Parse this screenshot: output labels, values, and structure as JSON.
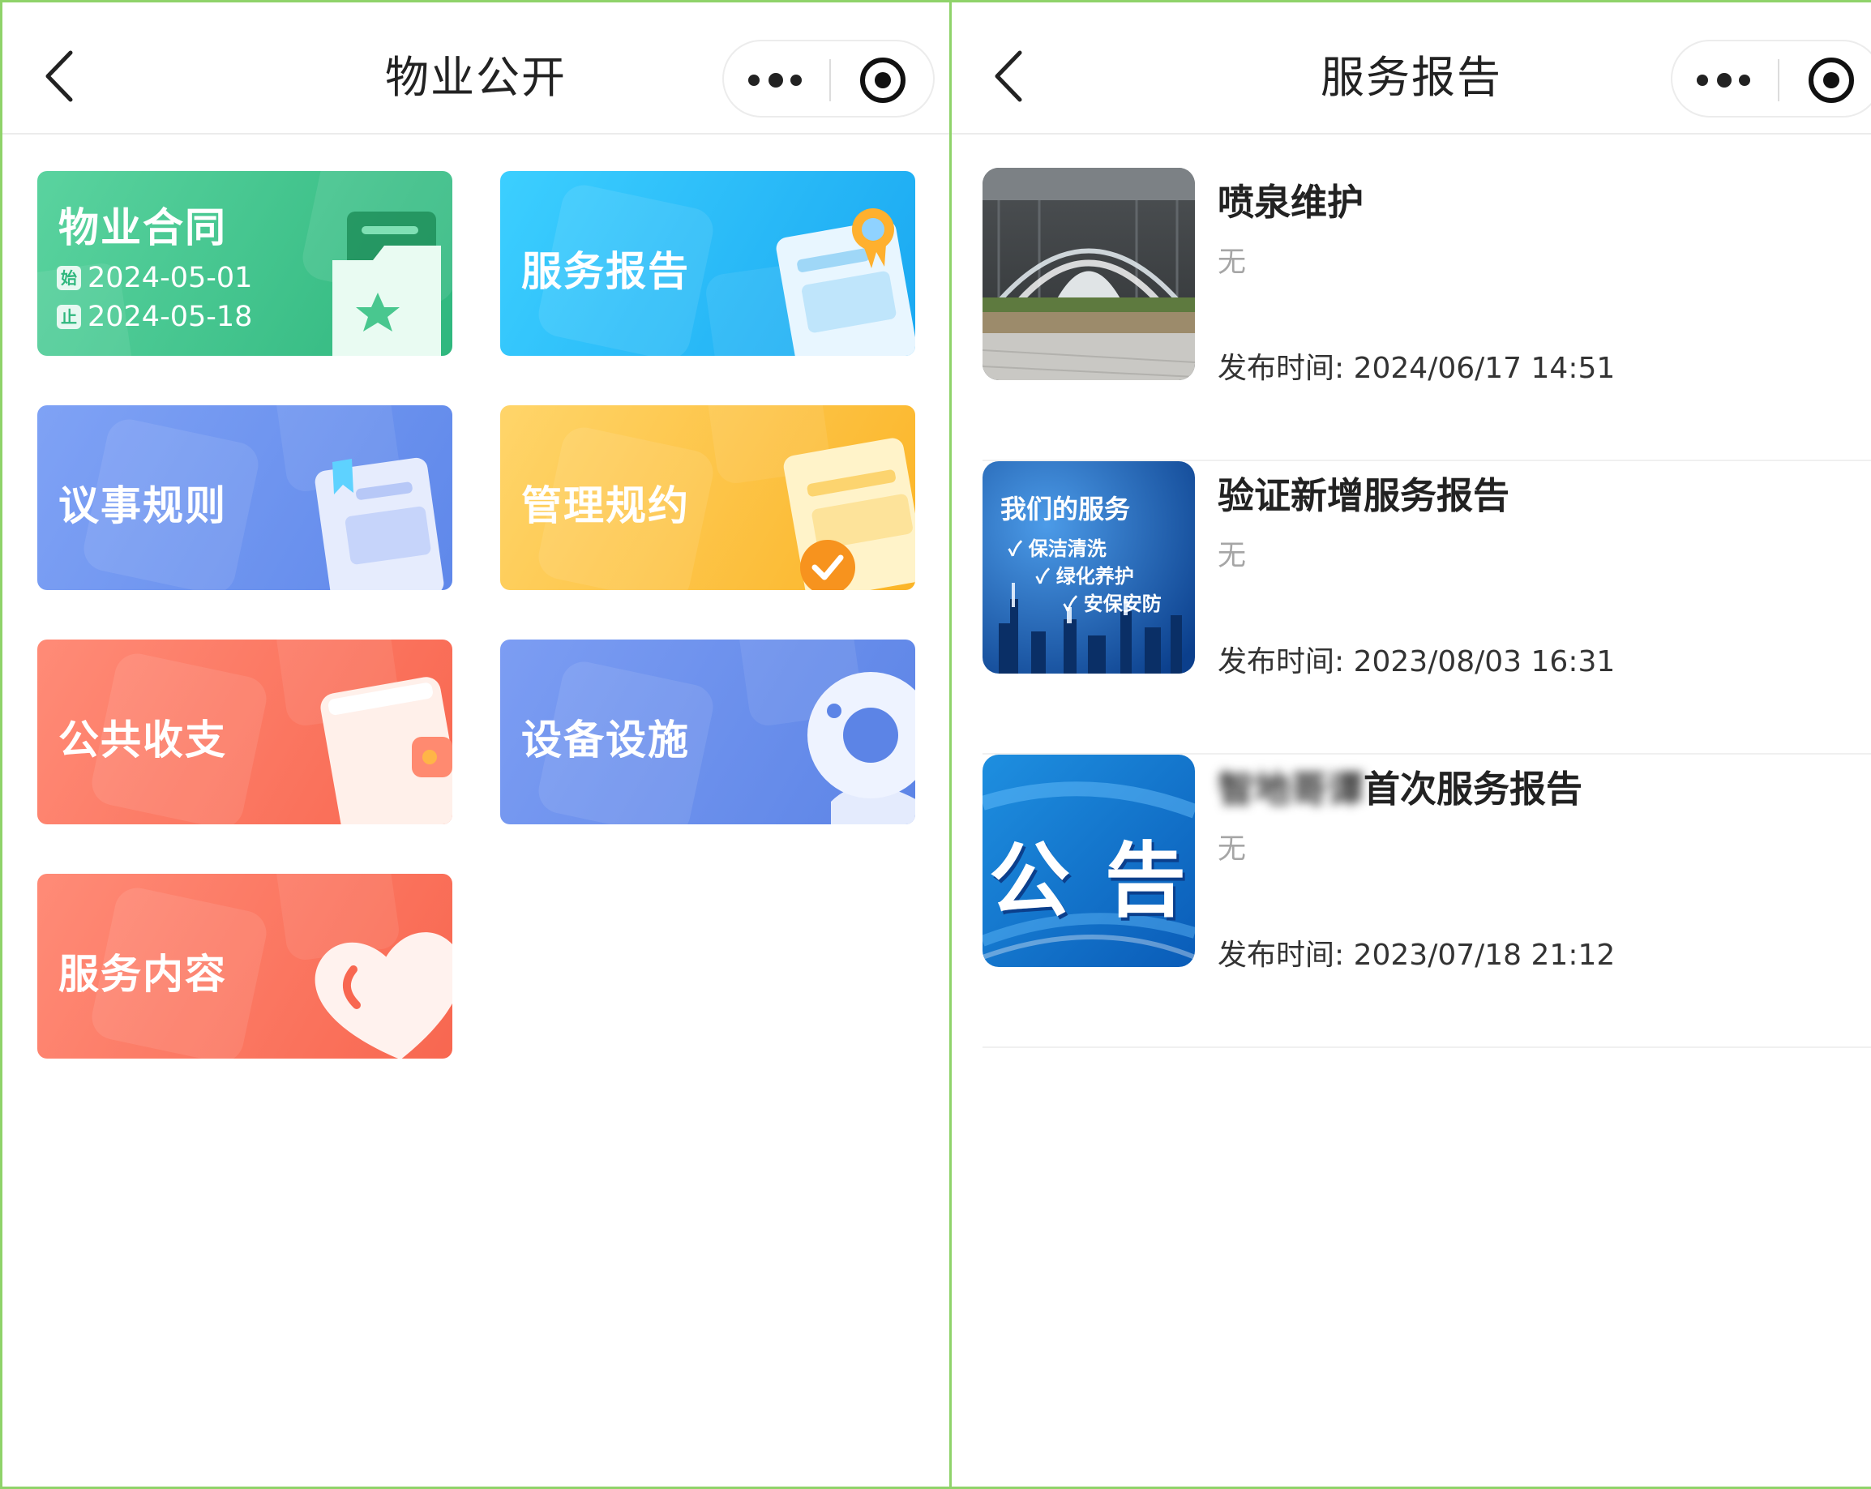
{
  "left_page": {
    "title": "物业公开",
    "cards": [
      {
        "label": "物业合同",
        "start_chip": "始",
        "start_date": "2024-05-01",
        "end_chip": "止",
        "end_date": "2024-05-18",
        "color": "#2fb77e"
      },
      {
        "label": "服务报告",
        "color": "#1aa8f1"
      },
      {
        "label": "议事规则",
        "color": "#5f88ea"
      },
      {
        "label": "管理规约",
        "color": "#fbb426"
      },
      {
        "label": "公共收支",
        "color": "#f86750"
      },
      {
        "label": "设备设施",
        "color": "#5c84e6"
      },
      {
        "label": "服务内容",
        "color": "#f86750"
      }
    ]
  },
  "right_page": {
    "title": "服务报告",
    "reports": [
      {
        "title": "喷泉维护",
        "desc": "无",
        "time_label": "发布时间: ",
        "time": "2024/06/17 14:51",
        "thumb": "fountain-photo"
      },
      {
        "title": "验证新增服务报告",
        "desc": "无",
        "time_label": "发布时间: ",
        "time": "2023/08/03 16:31",
        "thumb": "our-services-poster",
        "thumb_text": {
          "heading": "我们的服务",
          "lines": [
            "✓ 保洁清洗",
            "✓ 绿化养护",
            "✓ 安保安防"
          ]
        }
      },
      {
        "title_blurred": "智地哥谭",
        "title": "首次服务报告",
        "desc": "无",
        "time_label": "发布时间: ",
        "time": "2023/07/18 21:12",
        "thumb": "notice-poster",
        "thumb_text": {
          "heading": "公 告"
        }
      }
    ]
  },
  "icons": {
    "back": "chevron-left-icon",
    "more": "more-dots-icon",
    "close": "target-circle-icon"
  },
  "colors": {
    "frame_border": "#8fd36a",
    "divider": "#ececec",
    "secondary_text": "#a6a6a6"
  }
}
